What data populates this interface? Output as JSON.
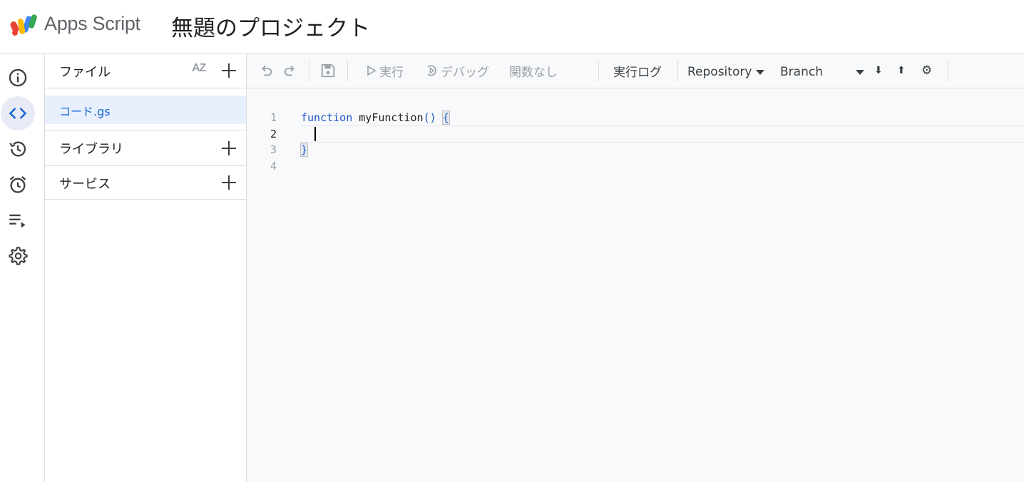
{
  "header": {
    "app_name": "Apps Script",
    "project_title": "無題のプロジェクト",
    "logo_icon": "apps-script-logo"
  },
  "leftrail": {
    "items": [
      {
        "name": "overview",
        "icon": "info-icon",
        "active": false
      },
      {
        "name": "editor",
        "icon": "code-icon",
        "active": true
      },
      {
        "name": "history",
        "icon": "history-icon",
        "active": false
      },
      {
        "name": "triggers",
        "icon": "alarm-icon",
        "active": false
      },
      {
        "name": "executions",
        "icon": "playlist-icon",
        "active": false
      },
      {
        "name": "settings",
        "icon": "gear-icon",
        "active": false
      }
    ]
  },
  "files_panel": {
    "files_label": "ファイル",
    "sort_label": "AZ",
    "file_name": "コード.gs",
    "libraries_label": "ライブラリ",
    "services_label": "サービス"
  },
  "toolbar": {
    "run_label": "実行",
    "debug_label": "デバッグ",
    "function_select_label": "関数なし",
    "exec_log_label": "実行ログ",
    "repository_label": "Repository",
    "branch_label": "Branch",
    "pull_glyph": "⬇",
    "push_glyph": "⬆",
    "gear_glyph": "⚙"
  },
  "code": {
    "line_numbers": [
      "1",
      "2",
      "3",
      "4"
    ],
    "keyword": "function",
    "function_name": "myFunction",
    "parens": "()",
    "open_brace": "{",
    "close_brace": "}"
  },
  "colors": {
    "accent": "#1967d2",
    "keyword": "#1a56c5",
    "selected_file_bg": "#e8f0fe",
    "editor_bg": "#f8f9fa",
    "divider": "#dadce0"
  }
}
